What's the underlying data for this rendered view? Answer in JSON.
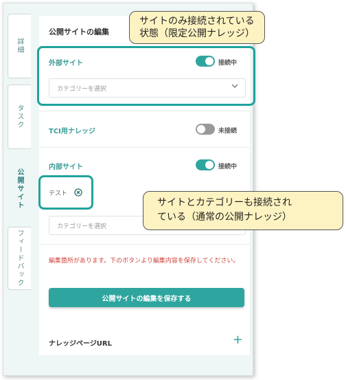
{
  "tabs": [
    {
      "label": "詳細",
      "active": false
    },
    {
      "label": "タスク",
      "active": false
    },
    {
      "label": "公開サイト",
      "active": true
    },
    {
      "label": "フィードバック",
      "active": false
    }
  ],
  "panel": {
    "title": "公開サイトの編集",
    "sections": [
      {
        "label": "外部サイト",
        "toggle": true,
        "status": "接続中",
        "select_placeholder": "カテゴリーを選択"
      },
      {
        "label": "TCI用ナレッジ",
        "toggle": false,
        "status": "未接続"
      },
      {
        "label": "内部サイト",
        "toggle": true,
        "status": "接続中",
        "tag": "テスト",
        "select_placeholder": "カテゴリーを選択"
      }
    ],
    "warning": "編集箇所があります。下のボタンより編集内容を保存してください。",
    "save_label": "公開サイトの編集を保存する"
  },
  "knowledge_url": {
    "label": "ナレッジページURL",
    "add_icon": "plus-icon"
  },
  "callouts": {
    "top": [
      "サイトのみ接続されている",
      "状態（限定公開ナレッジ）"
    ],
    "right": [
      "サイトとカテゴリーも接続され",
      "ている（通常の公開ナレッジ）"
    ]
  },
  "colors": {
    "accent": "#2fa59f",
    "highlight": "#1fa39c",
    "warning": "#d0453d",
    "callout_bg": "#fdf3c2"
  }
}
